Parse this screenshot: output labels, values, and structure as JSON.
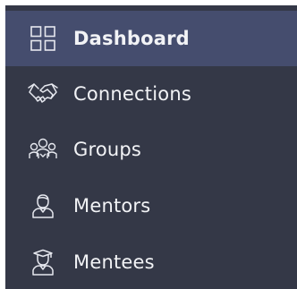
{
  "sidebar": {
    "colors": {
      "background": "#343847",
      "active_background": "#454d6e",
      "text": "#f2f3f6"
    },
    "items": [
      {
        "label": "Dashboard",
        "icon": "dashboard-grid-icon",
        "active": true
      },
      {
        "label": "Connections",
        "icon": "handshake-icon",
        "active": false
      },
      {
        "label": "Groups",
        "icon": "group-icon",
        "active": false
      },
      {
        "label": "Mentors",
        "icon": "mentor-icon",
        "active": false
      },
      {
        "label": "Mentees",
        "icon": "mentee-graduate-icon",
        "active": false
      }
    ]
  }
}
